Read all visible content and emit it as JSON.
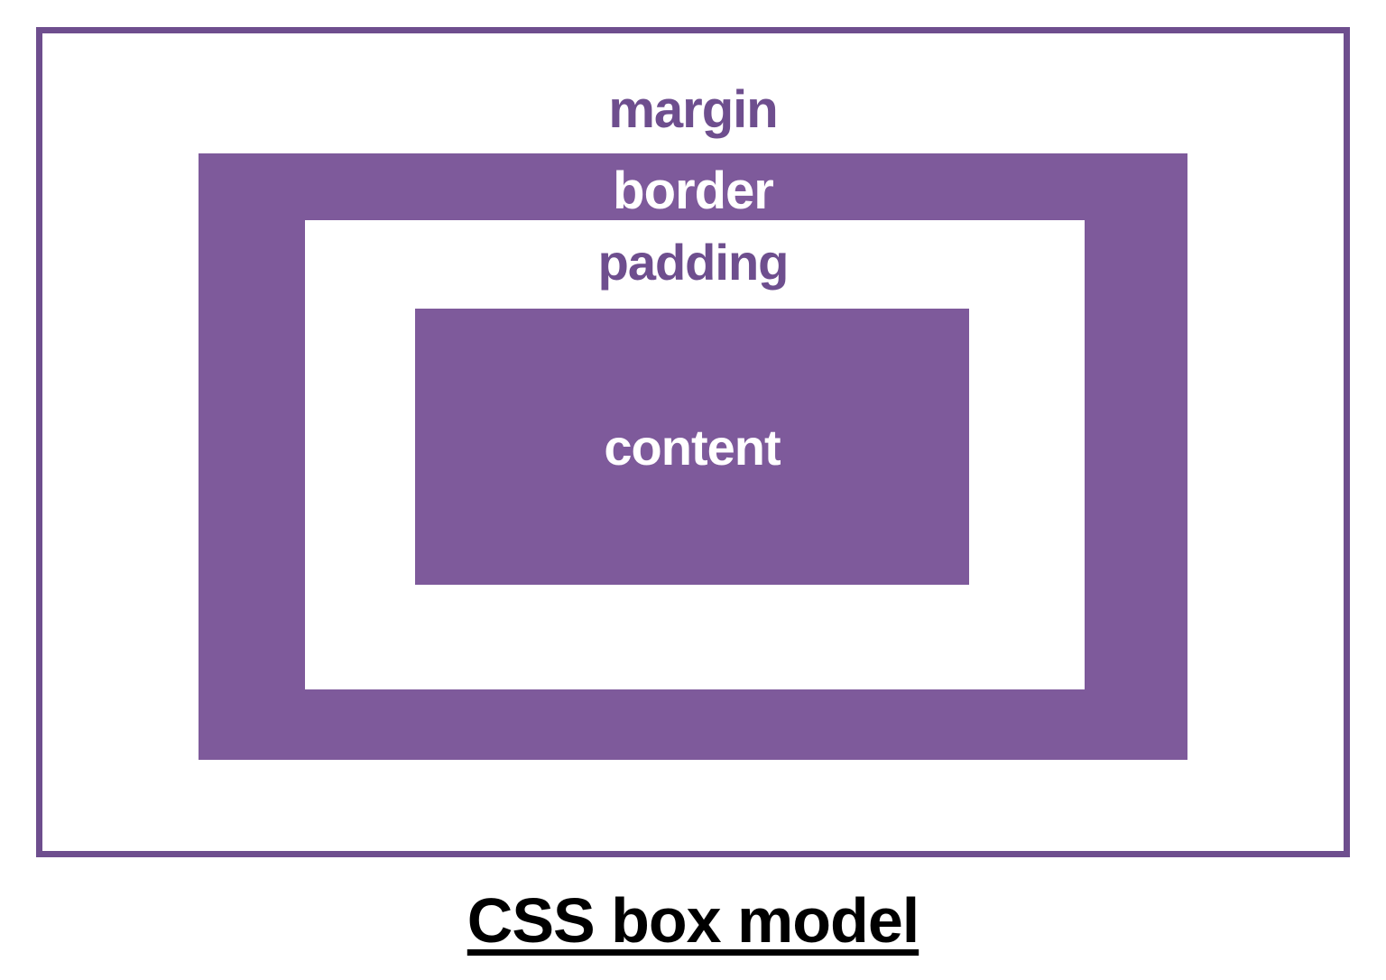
{
  "diagram": {
    "layers": {
      "margin": "margin",
      "border": "border",
      "padding": "padding",
      "content": "content"
    },
    "caption": "CSS box model",
    "colors": {
      "purple_fill": "#7e5a9b",
      "purple_text": "#6e4e8e",
      "white": "#ffffff",
      "black": "#000000"
    }
  }
}
